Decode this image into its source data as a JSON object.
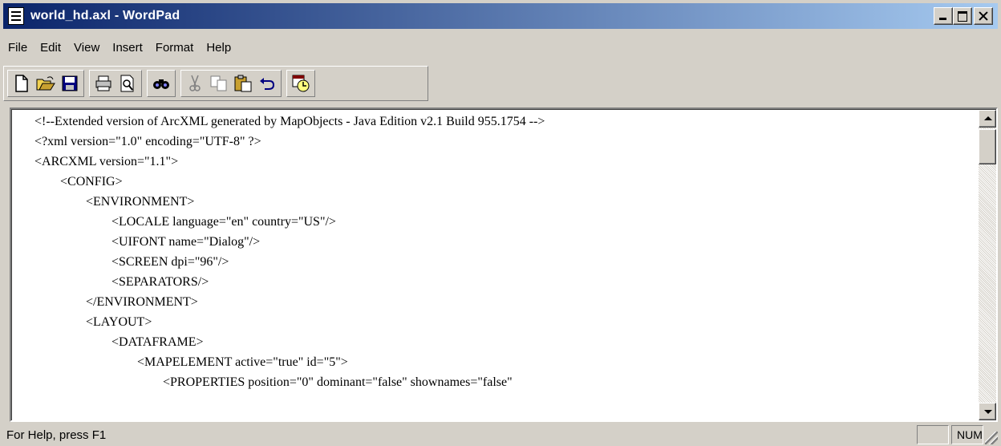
{
  "window": {
    "title": "world_hd.axl - WordPad"
  },
  "menu": [
    "File",
    "Edit",
    "View",
    "Insert",
    "Format",
    "Help"
  ],
  "toolbar": {
    "icons": [
      "new-icon",
      "open-icon",
      "save-icon",
      "print-icon",
      "print-preview-icon",
      "find-icon",
      "cut-icon",
      "copy-icon",
      "paste-icon",
      "undo-icon",
      "date-time-icon"
    ]
  },
  "document": {
    "lines": [
      "<!--Extended version of ArcXML generated by MapObjects - Java Edition v2.1 Build 955.1754 -->",
      "<?xml version=\"1.0\" encoding=\"UTF-8\" ?>",
      "<ARCXML version=\"1.1\">",
      "        <CONFIG>",
      "                <ENVIRONMENT>",
      "                        <LOCALE language=\"en\" country=\"US\"/>",
      "                        <UIFONT name=\"Dialog\"/>",
      "                        <SCREEN dpi=\"96\"/>",
      "                        <SEPARATORS/>",
      "                </ENVIRONMENT>",
      "                <LAYOUT>",
      "                        <DATAFRAME>",
      "                                <MAPELEMENT active=\"true\" id=\"5\">",
      "                                        <PROPERTIES position=\"0\" dominant=\"false\" shownames=\"false\""
    ]
  },
  "status": {
    "help_text": "For Help, press F1",
    "panel_caps": "",
    "panel_num": "NUM"
  },
  "colors": {
    "titlebar_start": "#0a246a",
    "titlebar_end": "#a6caf0",
    "face": "#d4d0c8"
  }
}
